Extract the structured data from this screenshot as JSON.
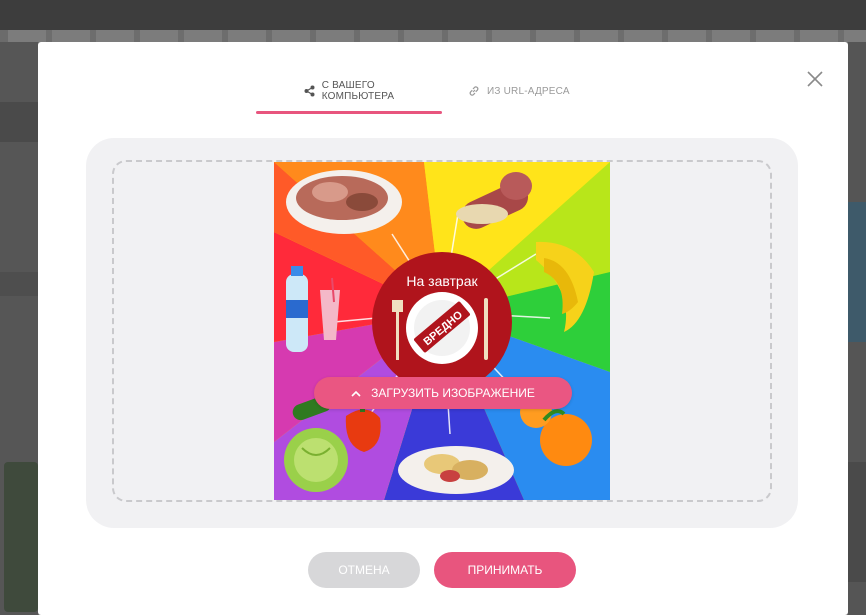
{
  "tabs": [
    {
      "label_line1": "С ВАШЕГО",
      "label_line2": "КОМПЬЮТЕРА",
      "icon": "share-icon",
      "active": true
    },
    {
      "label": "ИЗ URL-АДРЕСА",
      "icon": "link-icon",
      "active": false
    }
  ],
  "close": {
    "icon": "close-icon"
  },
  "preview": {
    "plate_title": "На завтрак",
    "stamp_text": "ВРЕДНО"
  },
  "upload_button": {
    "label": "ЗАГРУЗИТЬ ИЗОБРАЖЕНИЕ",
    "icon": "chevron-up-icon"
  },
  "footer": {
    "cancel_label": "ОТМЕНА",
    "accept_label": "ПРИНИМАТЬ"
  },
  "colors": {
    "accent": "#e8557e",
    "disabled": "#d7d7d9",
    "dropzone_bg": "#f1f1f3"
  }
}
